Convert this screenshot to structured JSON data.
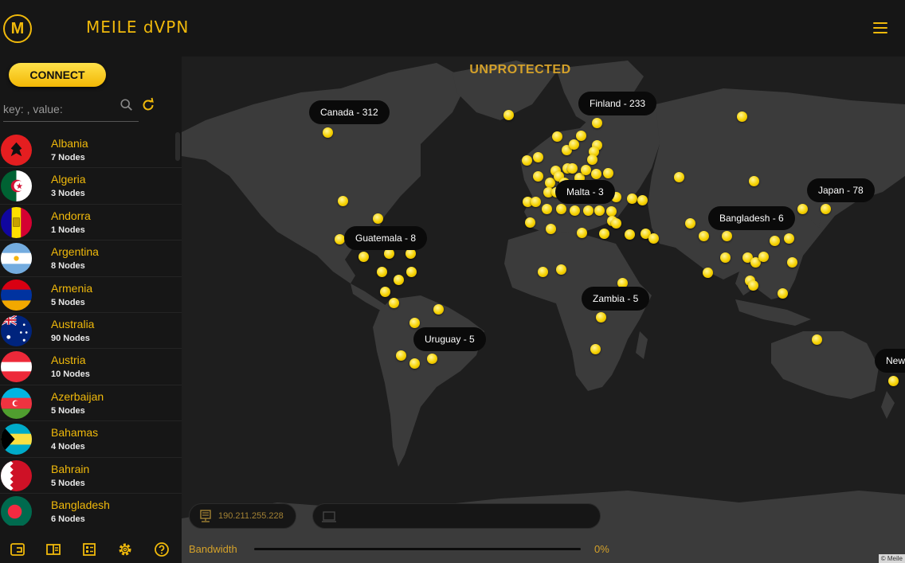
{
  "app": {
    "logo_letter": "M",
    "title": "MEILE dVPN",
    "accent_color": "#f0b90b"
  },
  "sidebar": {
    "connect_label": "CONNECT",
    "search_placeholder": "key: , value:",
    "countries": [
      {
        "name": "Albania",
        "nodes": "7 Nodes",
        "flag": "albania"
      },
      {
        "name": "Algeria",
        "nodes": "3 Nodes",
        "flag": "algeria"
      },
      {
        "name": "Andorra",
        "nodes": "1 Nodes",
        "flag": "andorra"
      },
      {
        "name": "Argentina",
        "nodes": "8 Nodes",
        "flag": "argentina"
      },
      {
        "name": "Armenia",
        "nodes": "5 Nodes",
        "flag": "armenia"
      },
      {
        "name": "Australia",
        "nodes": "90 Nodes",
        "flag": "australia"
      },
      {
        "name": "Austria",
        "nodes": "10 Nodes",
        "flag": "austria"
      },
      {
        "name": "Azerbaijan",
        "nodes": "5 Nodes",
        "flag": "azerbaijan"
      },
      {
        "name": "Bahamas",
        "nodes": "4 Nodes",
        "flag": "bahamas"
      },
      {
        "name": "Bahrain",
        "nodes": "5 Nodes",
        "flag": "bahrain"
      },
      {
        "name": "Bangladesh",
        "nodes": "6 Nodes",
        "flag": "bangladesh"
      }
    ],
    "bottom_icons": [
      "wallet-icon",
      "plans-icon",
      "subscriptions-icon",
      "settings-gear-icon",
      "help-icon"
    ]
  },
  "map": {
    "status": "UNPROTECTED",
    "callouts": {
      "canada": "Canada - 312",
      "finland": "Finland - 233",
      "malta": "Malta - 3",
      "japan": "Japan - 78",
      "bangladesh": "Bangladesh - 6",
      "guatemala": "Guatemala - 8",
      "zambia": "Zambia - 5",
      "uruguay": "Uruguay - 5",
      "newzealand": "New"
    },
    "ip_address": "190.211.255.228",
    "bandwidth_label": "Bandwidth",
    "bandwidth_fraction": 0.0,
    "bandwidth_percent": "0%",
    "attribution": "© Meile"
  }
}
